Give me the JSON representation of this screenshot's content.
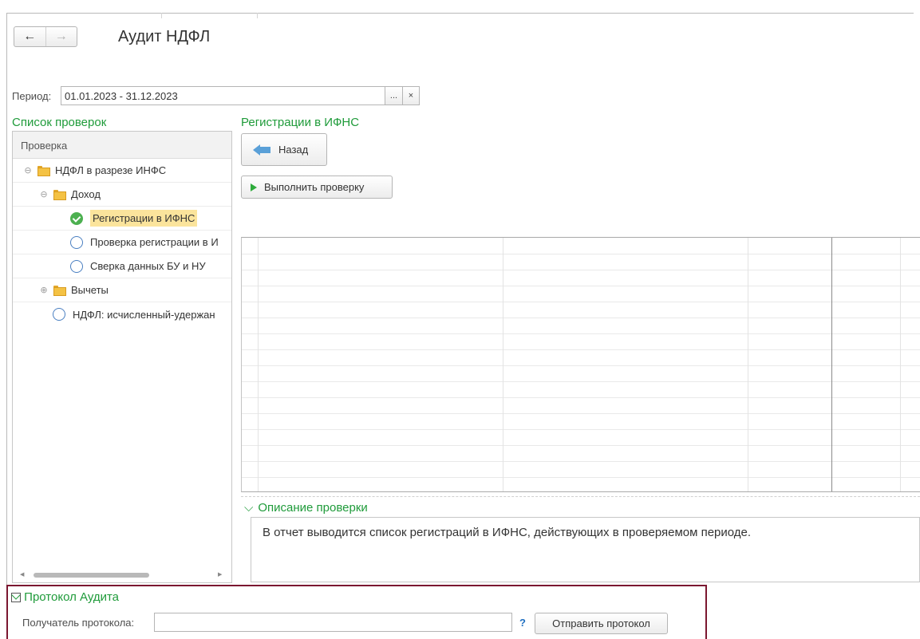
{
  "window": {
    "title": "Аудит НДФЛ"
  },
  "nav": {
    "back_glyph": "←",
    "forward_glyph": "→"
  },
  "period": {
    "label": "Период:",
    "value": "01.01.2023 - 31.12.2023",
    "choose_glyph": "...",
    "clear_glyph": "×"
  },
  "checks": {
    "title": "Список проверок",
    "column_header": "Проверка",
    "items": [
      {
        "label": "НДФЛ в разрезе ИНФС",
        "type": "folder",
        "expander": "⊖",
        "level": 0
      },
      {
        "label": "Доход",
        "type": "folder",
        "expander": "⊖",
        "level": 1
      },
      {
        "label": "Регистрации в ИФНС",
        "type": "check",
        "state": "done",
        "selected": true,
        "level": 2
      },
      {
        "label": "Проверка регистрации в И",
        "type": "check",
        "state": "pending",
        "level": 2
      },
      {
        "label": "Сверка данных БУ и НУ",
        "type": "check",
        "state": "pending",
        "level": 2
      },
      {
        "label": "Вычеты",
        "type": "folder",
        "expander": "⊕",
        "level": 1
      },
      {
        "label": "НДФЛ: исчисленный-удержан",
        "type": "check",
        "state": "pending",
        "level": 1
      }
    ]
  },
  "report": {
    "title": "Регистрации в ИФНС",
    "back_button": "Назад",
    "run_button": "Выполнить проверку",
    "description_toggle": "Описание проверки",
    "description_text": "В отчет выводится список регистраций в ИФНС, действующих в проверяемом периоде."
  },
  "protocol": {
    "title": "Протокол Аудита",
    "recipient_label": "Получатель протокола:",
    "recipient_value": "",
    "help_glyph": "?",
    "send_button": "Отправить протокол"
  },
  "colors": {
    "accent_green": "#1f9b3a",
    "selected_highlight": "#fbe49c",
    "frame_border": "#7b1730"
  },
  "icons": [
    "back-arrow-icon",
    "forward-arrow-icon",
    "folder-icon",
    "check-done-icon",
    "radio-pending-icon",
    "play-icon",
    "checkbox-icon",
    "help-icon"
  ]
}
